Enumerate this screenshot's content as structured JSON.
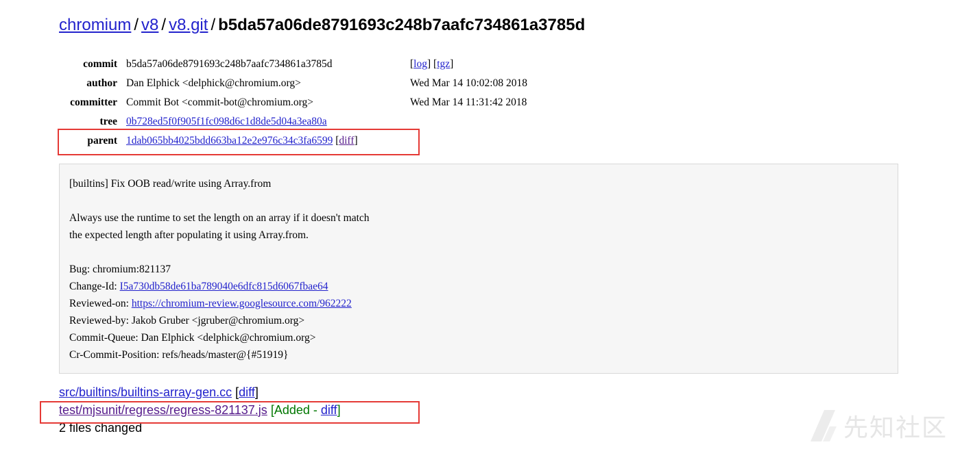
{
  "breadcrumb": {
    "items": [
      "chromium",
      "v8",
      "v8.git"
    ],
    "current": "b5da57a06de8791693c248b7aafc734861a3785d",
    "separator": "/"
  },
  "meta": {
    "commit": {
      "key": "commit",
      "value": "b5da57a06de8791693c248b7aafc734861a3785d",
      "log_label": "log",
      "tgz_label": "tgz"
    },
    "author": {
      "key": "author",
      "value": "Dan Elphick <delphick@chromium.org>",
      "date": "Wed Mar 14 10:02:08 2018"
    },
    "committer": {
      "key": "committer",
      "value": "Commit Bot <commit-bot@chromium.org>",
      "date": "Wed Mar 14 11:31:42 2018"
    },
    "tree": {
      "key": "tree",
      "value": "0b728ed5f0f905f1fc098d6c1d8de5d04a3ea80a"
    },
    "parent": {
      "key": "parent",
      "value": "1dab065bb4025bdd663ba12e2e976c34c3fa6599",
      "diff_label": "diff"
    }
  },
  "message": {
    "title": "[builtins] Fix OOB read/write using Array.from",
    "body1": "Always use the runtime to set the length on an array if it doesn't match",
    "body2": "the expected length after populating it using Array.from.",
    "bug": "Bug: chromium:821137",
    "change_id_label": "Change-Id: ",
    "change_id": "I5a730db58de61ba789040e6dfc815d6067fbae64",
    "reviewed_on_label": "Reviewed-on: ",
    "reviewed_on": "https://chromium-review.googlesource.com/962222",
    "reviewed_by": "Reviewed-by: Jakob Gruber <jgruber@chromium.org>",
    "commit_queue": "Commit-Queue: Dan Elphick <delphick@chromium.org>",
    "cr_commit_position": "Cr-Commit-Position: refs/heads/master@{#51919}"
  },
  "files": {
    "items": [
      {
        "path": "src/builtins/builtins-array-gen.cc",
        "diff_label": "diff"
      },
      {
        "path": "test/mjsunit/regress/regress-821137.js",
        "status": "Added - ",
        "diff_label": "diff"
      }
    ],
    "summary": "2 files changed"
  },
  "watermark": {
    "text": "先知社区"
  },
  "colors": {
    "link": "#2222cc",
    "visited": "#551a8b",
    "highlight": "#e53935",
    "added": "#007700",
    "message_bg": "#f6f6f6"
  }
}
